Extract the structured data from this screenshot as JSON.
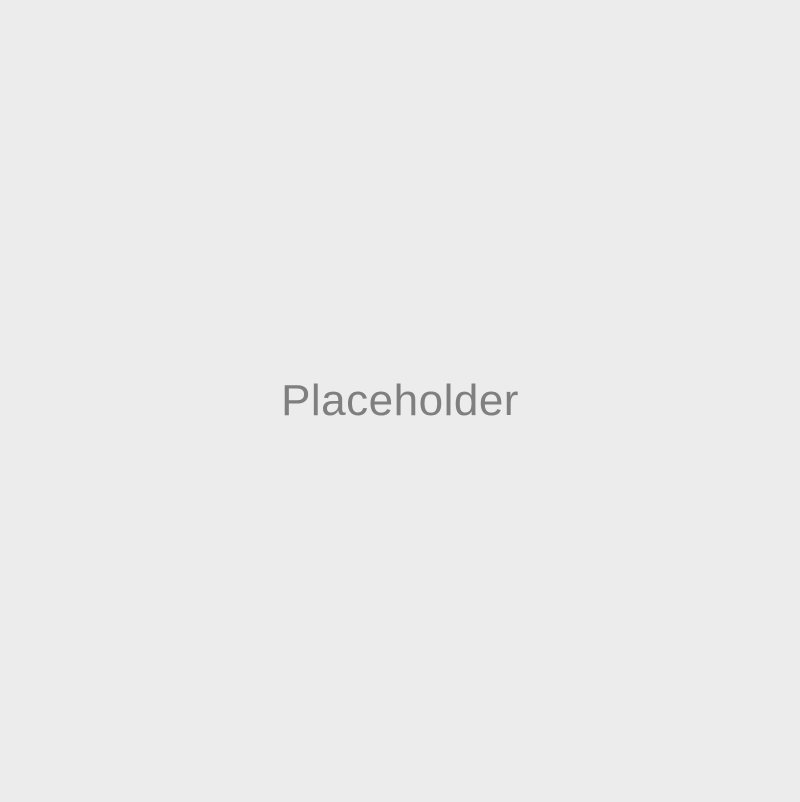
{
  "placeholder": {
    "label": "Placeholder",
    "background_color": "#ececec",
    "text_color": "#7f7f7f"
  }
}
